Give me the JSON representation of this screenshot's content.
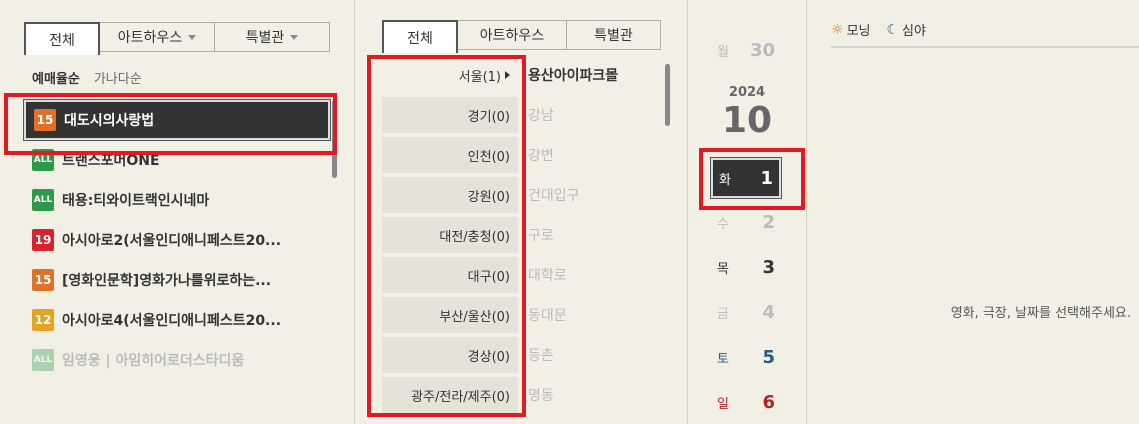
{
  "movie": {
    "tabs": [
      {
        "label": "전체",
        "dropdown": false,
        "active": true
      },
      {
        "label": "아트하우스",
        "dropdown": true,
        "active": false
      },
      {
        "label": "특별관",
        "dropdown": true,
        "active": false
      }
    ],
    "sort_options": [
      "예매율순",
      "가나다순"
    ],
    "items": [
      {
        "rating": "15",
        "title": "대도시의사랑법",
        "selected": true,
        "dim": false
      },
      {
        "rating": "ALL",
        "title": "트랜스포머ONE",
        "selected": false,
        "dim": false
      },
      {
        "rating": "ALL",
        "title": "태용:티와이트랙인시네마",
        "selected": false,
        "dim": false
      },
      {
        "rating": "19",
        "title": "아시아로2(서울인디애니페스트20...",
        "selected": false,
        "dim": false
      },
      {
        "rating": "15",
        "title": "[영화인문학]영화가나를위로하는...",
        "selected": false,
        "dim": false
      },
      {
        "rating": "12",
        "title": "아시아로4(서울인디애니페스트20...",
        "selected": false,
        "dim": false
      },
      {
        "rating": "ALL",
        "title": "임영웅 | 아임히어로더스타디움",
        "selected": false,
        "dim": true
      }
    ]
  },
  "theater": {
    "tabs": [
      {
        "label": "전체",
        "active": true
      },
      {
        "label": "아트하우스",
        "active": false
      },
      {
        "label": "특별관",
        "active": false
      }
    ],
    "regions": [
      "서울(1)",
      "경기(0)",
      "인천(0)",
      "강원(0)",
      "대전/충청(0)",
      "대구(0)",
      "부산/울산(0)",
      "경상(0)",
      "광주/전라/제주(0)"
    ],
    "cinemas": [
      "용산아이파크몰",
      "강남",
      "강변",
      "건대입구",
      "구로",
      "대학로",
      "동대문",
      "등촌",
      "명동"
    ]
  },
  "date": {
    "prev_day": {
      "weekday": "월",
      "day": "30"
    },
    "year": "2024",
    "month": "10",
    "days": [
      {
        "weekday": "화",
        "day": "1",
        "selected": true,
        "color": "#ffffff"
      },
      {
        "weekday": "수",
        "day": "2",
        "selected": false,
        "color": "#bbbbbb"
      },
      {
        "weekday": "목",
        "day": "3",
        "selected": false,
        "color": "#333333"
      },
      {
        "weekday": "금",
        "day": "4",
        "selected": false,
        "color": "#bbbbbb"
      },
      {
        "weekday": "토",
        "day": "5",
        "selected": false,
        "color": "#31597e"
      },
      {
        "weekday": "일",
        "day": "6",
        "selected": false,
        "color": "#ad2727"
      }
    ]
  },
  "time": {
    "morning_label": "모닝",
    "night_label": "심야",
    "message": "영화, 극장, 날짜를 선택해주세요."
  },
  "rating_colors": {
    "15": "#e07128",
    "ALL": "#2d9a4a",
    "19": "#d5242f",
    "12": "#e6a321"
  }
}
